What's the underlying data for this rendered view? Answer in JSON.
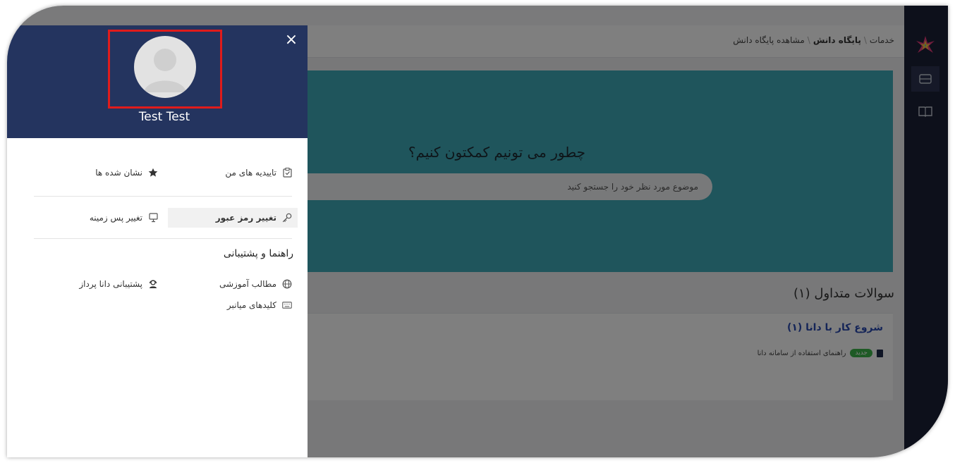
{
  "breadcrumb": {
    "root": "خدمات",
    "current": "پایگاه دانش",
    "page": "مشاهده پایگاه دانش",
    "separator": "\\"
  },
  "hero": {
    "title": "چطور می تونیم کمکتون کنیم؟",
    "search_placeholder": "موضوع مورد نظر خود را جستجو کنید"
  },
  "questions": {
    "heading": "سوالات متداول (۱)",
    "category": "شروع کار با دانا (۱)",
    "items": [
      {
        "badge": "جدید",
        "title": "راهنمای استفاده از سامانه دانا"
      }
    ]
  },
  "drawer": {
    "close_label": "×",
    "user_name": "Test Test",
    "menu": {
      "approvals": "تاییدیه های من",
      "bookmarks": "نشان شده ها",
      "change_password": "تغییر رمز عبور",
      "change_background": "تغییر پس زمینه"
    },
    "help_section": {
      "title": "راهنما و پشتیبانی",
      "tutorials": "مطالب آموزشی",
      "support": "پشتیبانی دانا پرداز",
      "shortcuts": "کلیدهای میانبر"
    }
  },
  "colors": {
    "drawer_header": "#24345f",
    "rail": "#1b2036",
    "hero": "#3eaab8",
    "highlight_box": "#e01b1b",
    "category_link": "#2b4bb0",
    "badge": "#3cb44a"
  },
  "icons": {
    "rail": [
      "logo-icon",
      "ticket-icon",
      "book-icon"
    ],
    "menu": [
      "clipboard-check-icon",
      "star-icon",
      "key-icon",
      "monitor-icon",
      "globe-icon",
      "support-agent-icon",
      "keyboard-icon"
    ]
  }
}
